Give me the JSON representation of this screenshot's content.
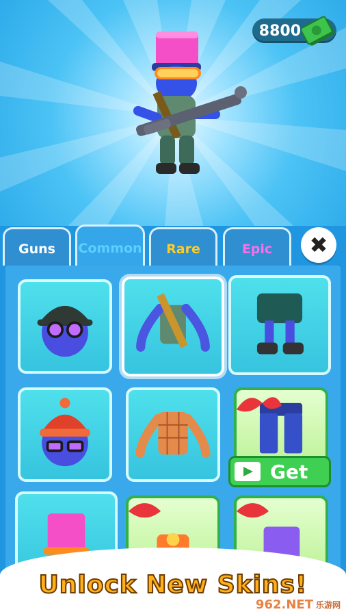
{
  "currency": {
    "amount": "8800",
    "icon": "cash-stack-icon"
  },
  "tabs": [
    {
      "label": "Guns",
      "color": "#ffffff",
      "active": false
    },
    {
      "label": "Common",
      "color": "#5ad1ff",
      "active": true
    },
    {
      "label": "Rare",
      "color": "#ffcc22",
      "active": false
    },
    {
      "label": "Epic",
      "color": "#ff6ee8",
      "active": false
    }
  ],
  "close_icon": "close-icon",
  "items": [
    {
      "name": "helmet-goggles",
      "state": "owned"
    },
    {
      "name": "ammo-vest-shirt",
      "state": "selected"
    },
    {
      "name": "cargo-shorts-boots",
      "state": "owned"
    },
    {
      "name": "red-beanie-glasses",
      "state": "owned"
    },
    {
      "name": "plaid-shirt",
      "state": "owned"
    },
    {
      "name": "blue-pants",
      "state": "locked-video"
    },
    {
      "name": "pink-hat",
      "state": "owned"
    },
    {
      "name": "orange-shirt",
      "state": "locked-gift"
    },
    {
      "name": "purple-pants",
      "state": "locked-gift"
    }
  ],
  "get_button": {
    "label": "Get",
    "icon": "video-icon"
  },
  "banner": {
    "text": "Unlock New Skins!"
  },
  "watermark": {
    "main": "962.NET",
    "sub": "乐游网"
  }
}
